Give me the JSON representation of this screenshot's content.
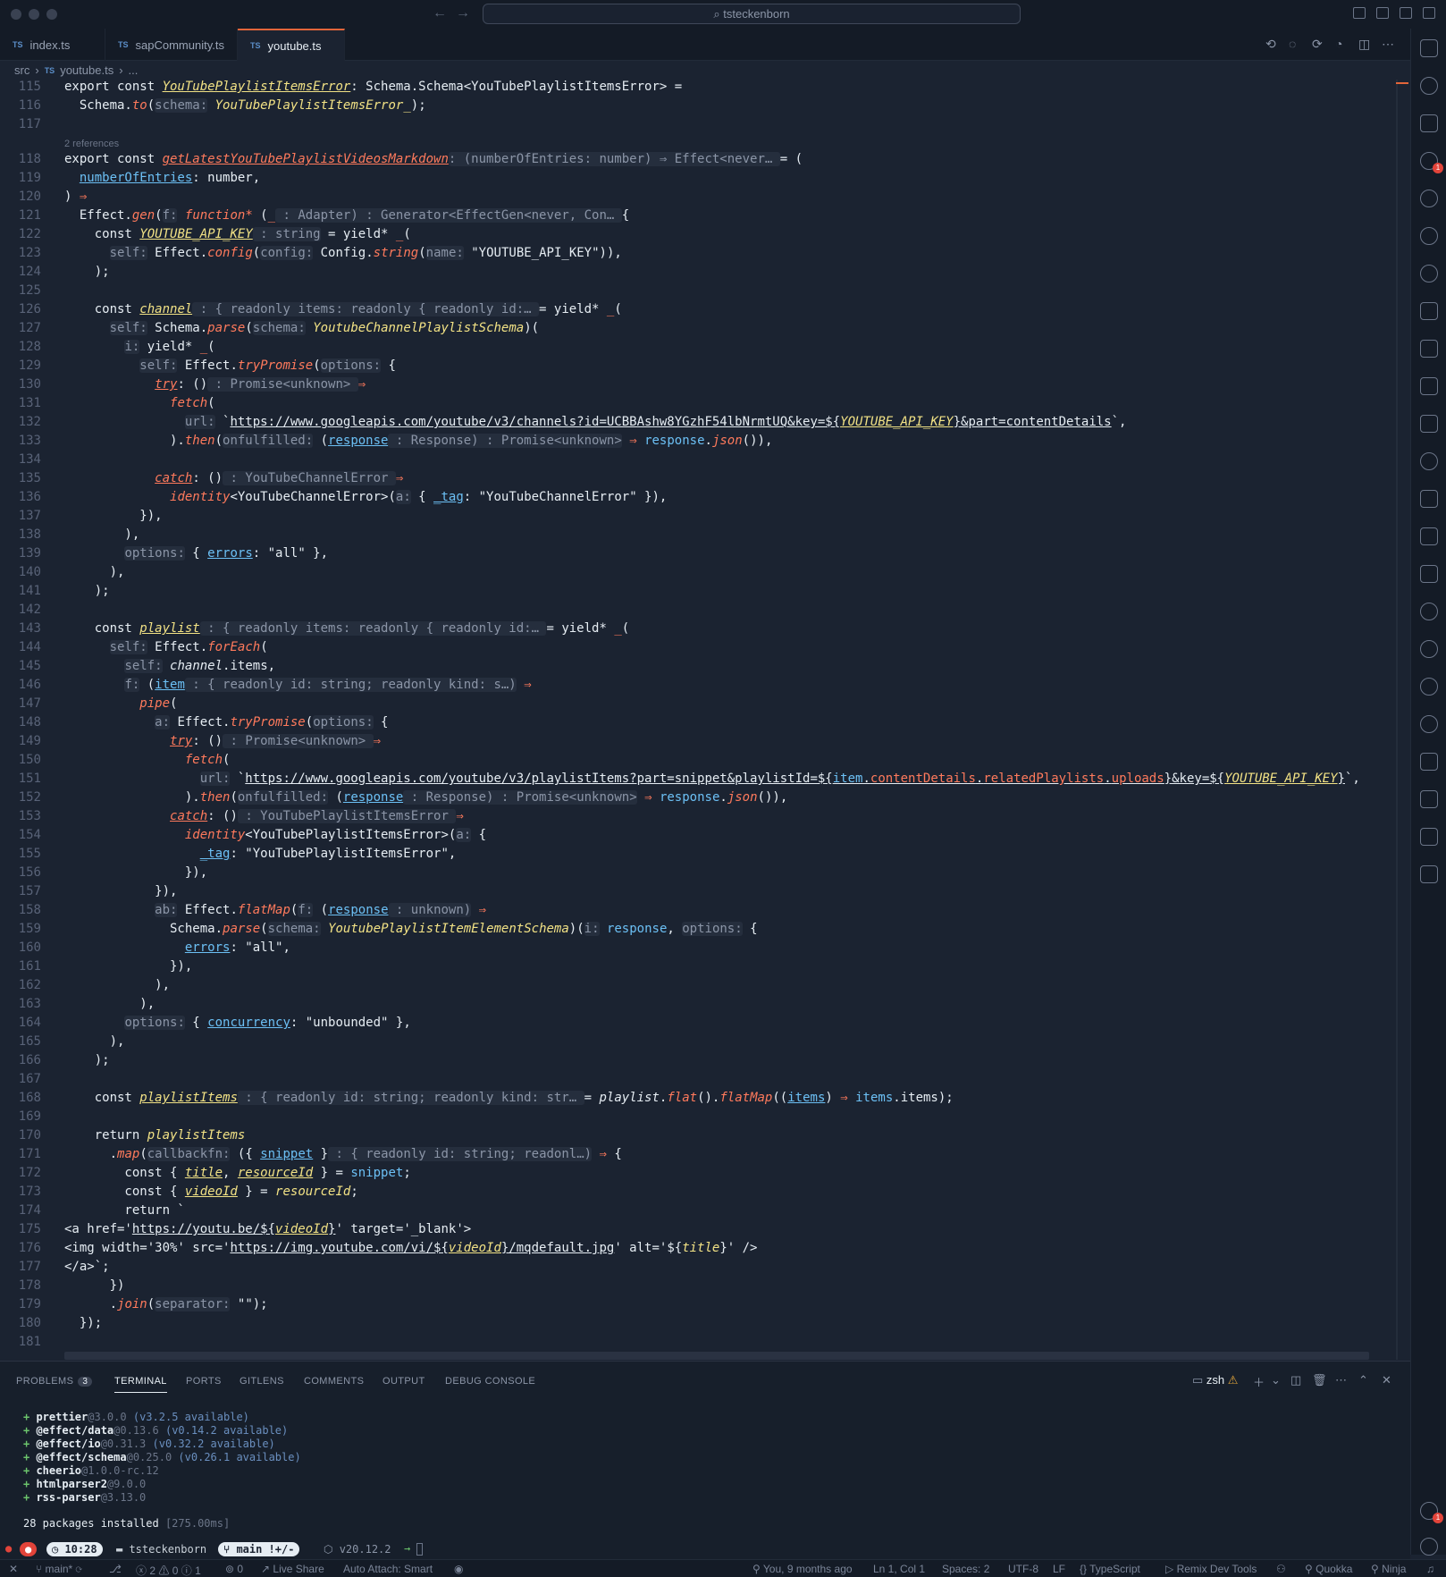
{
  "window": {
    "search": "tsteckenborn"
  },
  "tabs": [
    {
      "label": "index.ts",
      "lang": "TS"
    },
    {
      "label": "sapCommunity.ts",
      "lang": "TS"
    },
    {
      "label": "youtube.ts",
      "lang": "TS"
    }
  ],
  "breadcrumb": [
    "src",
    "TS",
    "youtube.ts",
    "..."
  ],
  "editor": {
    "references": "2 references",
    "line_numbers": [
      "115",
      "116",
      "117",
      "118",
      "119",
      "120",
      "121",
      "122",
      "123",
      "124",
      "125",
      "126",
      "127",
      "128",
      "129",
      "130",
      "131",
      "132",
      "133",
      "134",
      "135",
      "136",
      "137",
      "138",
      "139",
      "140",
      "141",
      "142",
      "143",
      "144",
      "145",
      "146",
      "147",
      "148",
      "149",
      "150",
      "151",
      "152",
      "153",
      "154",
      "155",
      "156",
      "157",
      "158",
      "159",
      "160",
      "161",
      "162",
      "163",
      "164",
      "165",
      "166",
      "167",
      "168",
      "169",
      "170",
      "171",
      "172",
      "173",
      "174",
      "175",
      "176",
      "177",
      "178",
      "179",
      "180",
      "181"
    ]
  },
  "panel": {
    "tabs": [
      "PROBLEMS",
      "TERMINAL",
      "PORTS",
      "GITLENS",
      "COMMENTS",
      "OUTPUT",
      "DEBUG CONSOLE"
    ],
    "problems_count": "3",
    "shell": "zsh",
    "terminal": [
      {
        "name": "prettier",
        "ver": "@3.0.0",
        "avail": "(v3.2.5 available)"
      },
      {
        "name": "@effect/data",
        "ver": "@0.13.6",
        "avail": "(v0.14.2 available)"
      },
      {
        "name": "@effect/io",
        "ver": "@0.31.3",
        "avail": "(v0.32.2 available)"
      },
      {
        "name": "@effect/schema",
        "ver": "@0.25.0",
        "avail": "(v0.26.1 available)"
      },
      {
        "name": "cheerio",
        "ver": "@1.0.0-rc.12",
        "avail": ""
      },
      {
        "name": "htmlparser2",
        "ver": "@9.0.0",
        "avail": ""
      },
      {
        "name": "rss-parser",
        "ver": "@3.13.0",
        "avail": ""
      }
    ],
    "installed": "28 packages installed",
    "installed_time": "[275.00ms]"
  },
  "prompt": {
    "time": "10:28",
    "dir": "tsteckenborn",
    "branch": "main !+/-",
    "node": "v20.12.2"
  },
  "statusbar": {
    "branch": "main*",
    "errors": "2",
    "warnings": "0",
    "info": "1",
    "ports": "0",
    "live_share": "Live Share",
    "auto_attach": "Auto Attach: Smart",
    "blame": "You, 9 months ago",
    "position": "Ln 1, Col 1",
    "spaces": "Spaces: 2",
    "encoding": "UTF-8",
    "eol": "LF",
    "language": "TypeScript",
    "remix": "Remix Dev Tools",
    "quokka": "Quokka",
    "ninja": "Ninja"
  },
  "colors": {
    "accent": "#e2653a",
    "background": "#1b2331",
    "function": "#ff7a5c",
    "type": "#f2e285",
    "param": "#6cc0f5"
  }
}
